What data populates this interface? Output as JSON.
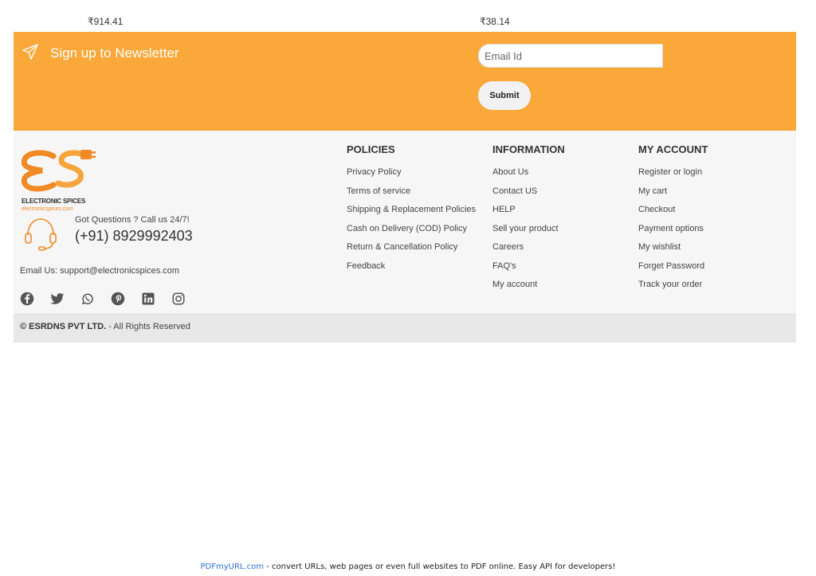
{
  "prices": [
    "₹914.41",
    "₹38.14"
  ],
  "newsletter": {
    "title": "Sign up to Newsletter",
    "email_placeholder": "Email Id",
    "submit_label": "Submit",
    "icon": "paper-plane-icon"
  },
  "brand": {
    "name": "ELECTRONIC SPICES",
    "site": "electronicspices.com",
    "primary_color": "#f9a839"
  },
  "contact": {
    "question": "Got Questions ? Call us 24/7!",
    "phone": "(+91) 8929992403",
    "email_line": "Email Us: support@electronicspices.com",
    "icon": "headset-icon"
  },
  "socials": [
    "facebook-icon",
    "twitter-icon",
    "whatsapp-icon",
    "pinterest-icon",
    "linkedin-icon",
    "instagram-icon"
  ],
  "columns": {
    "policies": {
      "title": "POLICIES",
      "links": [
        "Privacy Policy",
        "Terms of service",
        "Shipping & Replacement Policies",
        "Cash on Delivery (COD) Policy",
        "Return & Cancellation Policy",
        "Feedback"
      ]
    },
    "information": {
      "title": "INFORMATION",
      "links": [
        "About Us",
        "Contact US",
        "HELP",
        "Sell your product",
        "Careers",
        "FAQ's",
        "My account"
      ]
    },
    "account": {
      "title": "MY ACCOUNT",
      "links": [
        "Register or login",
        "My cart",
        "Checkout",
        "Payment options",
        "My wishlist",
        "Forget Password",
        "Track your order"
      ]
    }
  },
  "copyright": {
    "company": "© ESRDNS PVT LTD.",
    "suffix": " - All Rights Reserved"
  },
  "pdf_banner": {
    "link": "PDFmyURL.com",
    "text": " - convert URLs, web pages or even full websites to PDF online. Easy API for developers!"
  }
}
